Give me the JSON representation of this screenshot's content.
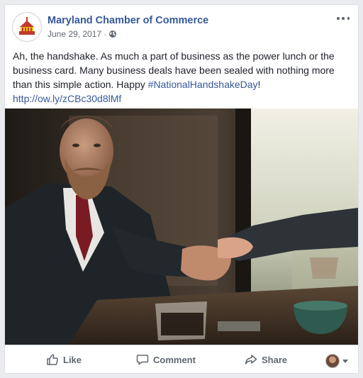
{
  "post": {
    "page_name": "Maryland Chamber of Commerce",
    "date": "June 29, 2017",
    "separator": "·",
    "privacy_icon": "globe-icon",
    "text_lead": "Ah, the handshake. As much a part of business as the power lunch or the business card. Many business deals have been sealed with nothing more than this simple action. Happy ",
    "hashtag": "#NationalHandshakeDay",
    "text_tail": "!",
    "link": "http://ow.ly/zCBc30d8lMf",
    "image_subject": "Bearded businessman in suit shaking hands across a cafe table with coffee cups"
  },
  "actions": {
    "like": "Like",
    "comment": "Comment",
    "share": "Share"
  },
  "colors": {
    "link": "#365899",
    "text": "#1d2129",
    "muted": "#616770"
  }
}
